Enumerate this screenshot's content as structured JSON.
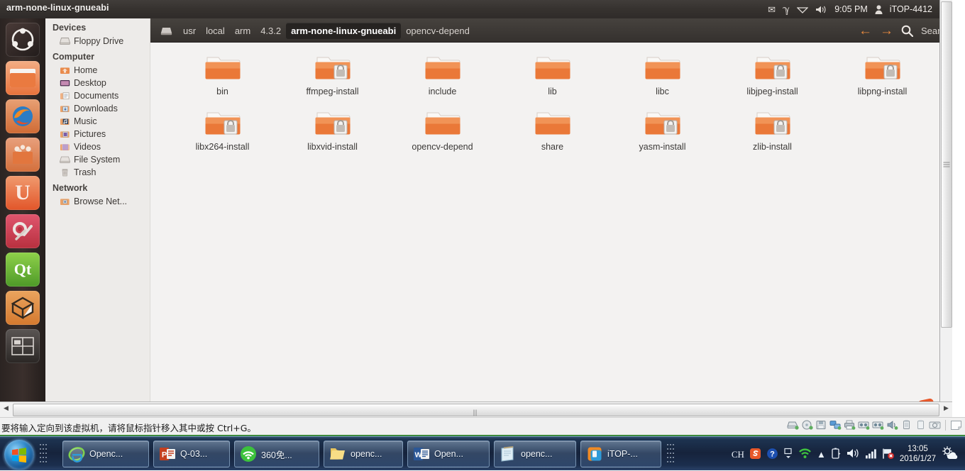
{
  "guest": {
    "panel": {
      "title": "arm-none-linux-gnueabi",
      "clock": "9:05 PM",
      "user": "iTOP-4412",
      "icons": [
        "mail-icon",
        "bluetooth-icon",
        "wifi-icon",
        "volume-icon",
        "user-icon",
        "power-icon"
      ]
    },
    "launcher": {
      "items": [
        {
          "name": "dash-home",
          "label": "Ubuntu Dash Home"
        },
        {
          "name": "files",
          "label": "Files"
        },
        {
          "name": "firefox",
          "label": "Firefox Web Browser"
        },
        {
          "name": "software-center",
          "label": "Ubuntu Software Center"
        },
        {
          "name": "ubuntu-one",
          "label": "Ubuntu One"
        },
        {
          "name": "system-settings",
          "label": "System Settings"
        },
        {
          "name": "qt-creator",
          "label": "Qt Creator"
        },
        {
          "name": "virtualbox",
          "label": "VirtualBox"
        },
        {
          "name": "workspace-switcher",
          "label": "Workspace Switcher"
        }
      ]
    },
    "toolbar": {
      "breadcrumbs": [
        {
          "label": "usr",
          "current": false
        },
        {
          "label": "local",
          "current": false
        },
        {
          "label": "arm",
          "current": false
        },
        {
          "label": "4.3.2",
          "current": false
        },
        {
          "label": "arm-none-linux-gnueabi",
          "current": true
        },
        {
          "label": "opencv-depend",
          "current": false
        }
      ],
      "back_icon": "back-arrow-icon",
      "forward_icon": "forward-arrow-icon",
      "search_icon": "search-icon",
      "search_text": "Searc"
    },
    "sidebar": {
      "groups": [
        {
          "heading": "Devices",
          "items": [
            {
              "label": "Floppy Drive",
              "icon": "floppy-drive-icon"
            }
          ]
        },
        {
          "heading": "Computer",
          "items": [
            {
              "label": "Home",
              "icon": "home-folder-icon"
            },
            {
              "label": "Desktop",
              "icon": "desktop-icon"
            },
            {
              "label": "Documents",
              "icon": "documents-folder-icon"
            },
            {
              "label": "Downloads",
              "icon": "downloads-folder-icon"
            },
            {
              "label": "Music",
              "icon": "music-folder-icon"
            },
            {
              "label": "Pictures",
              "icon": "pictures-folder-icon"
            },
            {
              "label": "Videos",
              "icon": "videos-folder-icon"
            },
            {
              "label": "File System",
              "icon": "file-system-icon"
            },
            {
              "label": "Trash",
              "icon": "trash-icon"
            }
          ]
        },
        {
          "heading": "Network",
          "items": [
            {
              "label": "Browse Net...",
              "icon": "network-folder-icon"
            }
          ]
        }
      ]
    },
    "files": [
      {
        "name": "bin",
        "locked": false
      },
      {
        "name": "ffmpeg-install",
        "locked": true
      },
      {
        "name": "include",
        "locked": false
      },
      {
        "name": "lib",
        "locked": false
      },
      {
        "name": "libc",
        "locked": false
      },
      {
        "name": "libjpeg-install",
        "locked": true
      },
      {
        "name": "libpng-install",
        "locked": true
      },
      {
        "name": "libx264-install",
        "locked": true
      },
      {
        "name": "libxvid-install",
        "locked": true
      },
      {
        "name": "opencv-depend",
        "locked": false
      },
      {
        "name": "share",
        "locked": false
      },
      {
        "name": "yasm-install",
        "locked": true
      },
      {
        "name": "zlib-install",
        "locked": true
      }
    ],
    "watermark": "sogou-logo-icon"
  },
  "vm": {
    "hint": "要将输入定向到该虚拟机，请将鼠标指针移入其中或按 Ctrl+G。",
    "devices": [
      "harddisk-icon",
      "cdrom-icon",
      "floppy-icon",
      "network-icon",
      "printer-icon",
      "usb-icon",
      "usb2-icon",
      "sound-icon",
      "usb-device-icon",
      "usb-device2-icon",
      "camera-icon",
      "message-icon"
    ]
  },
  "taskbar": {
    "start_label": "Start",
    "buttons": [
      {
        "label": "Openc...",
        "icon": "internet-explorer-icon"
      },
      {
        "label": "Q-03...",
        "icon": "powerpoint-icon"
      },
      {
        "label": "360免...",
        "icon": "360-security-icon"
      },
      {
        "label": "openc...",
        "icon": "folder-icon"
      },
      {
        "label": "Open...",
        "icon": "word-icon"
      },
      {
        "label": "openc...",
        "icon": "notepad-icon"
      },
      {
        "label": "iTOP-...",
        "icon": "vmware-icon"
      }
    ],
    "tray": {
      "ime": "CH",
      "icons": [
        "sogou-icon",
        "help-icon",
        "window-icon",
        "wifi-icon",
        "show-hidden-icon",
        "battery-icon",
        "volume-icon",
        "signal-icon",
        "flag-error-icon",
        "weather-icon"
      ],
      "time": "13:05",
      "date": "2016/1/27"
    }
  }
}
